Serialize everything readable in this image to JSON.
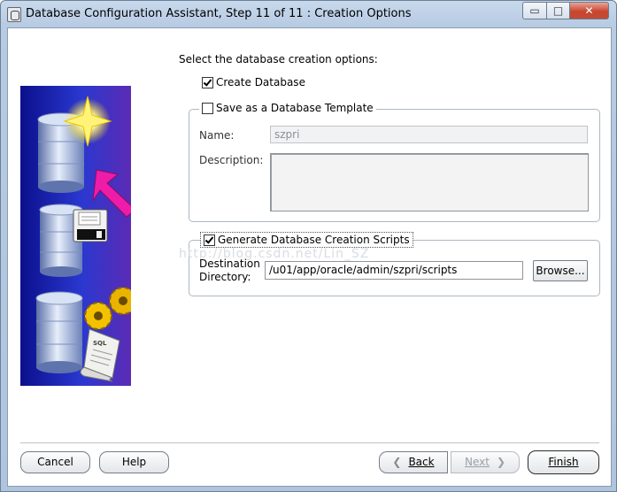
{
  "window": {
    "title": "Database Configuration Assistant, Step 11 of 11 : Creation Options",
    "min_symbol": "▭",
    "max_symbol": "□",
    "close_symbol": "✕"
  },
  "content": {
    "prompt": "Select the database creation options:",
    "create_db": {
      "label": "Create Database",
      "checked": true
    },
    "template": {
      "label": "Save as a Database Template",
      "checked": false,
      "name_label": "Name:",
      "name_value": "szpri",
      "description_label": "Description:",
      "description_value": ""
    },
    "scripts": {
      "label": "Generate Database Creation Scripts",
      "checked": true,
      "dest_label_1": "Destination",
      "dest_label_2": "Directory:",
      "dest_value": "/u01/app/oracle/admin/szpri/scripts",
      "browse_label": "Browse..."
    },
    "watermark": "http://blog.csdn.net/Lin_SZ"
  },
  "footer": {
    "cancel": "Cancel",
    "help": "Help",
    "back": "Back",
    "next": "Next",
    "finish": "Finish",
    "back_arrow": "❮",
    "next_arrow": "❯"
  },
  "icons": [
    "database-stack-illustration",
    "star-icon",
    "arrow-icon",
    "floppy-disk-icon",
    "gear-icon",
    "sql-scroll-icon"
  ]
}
